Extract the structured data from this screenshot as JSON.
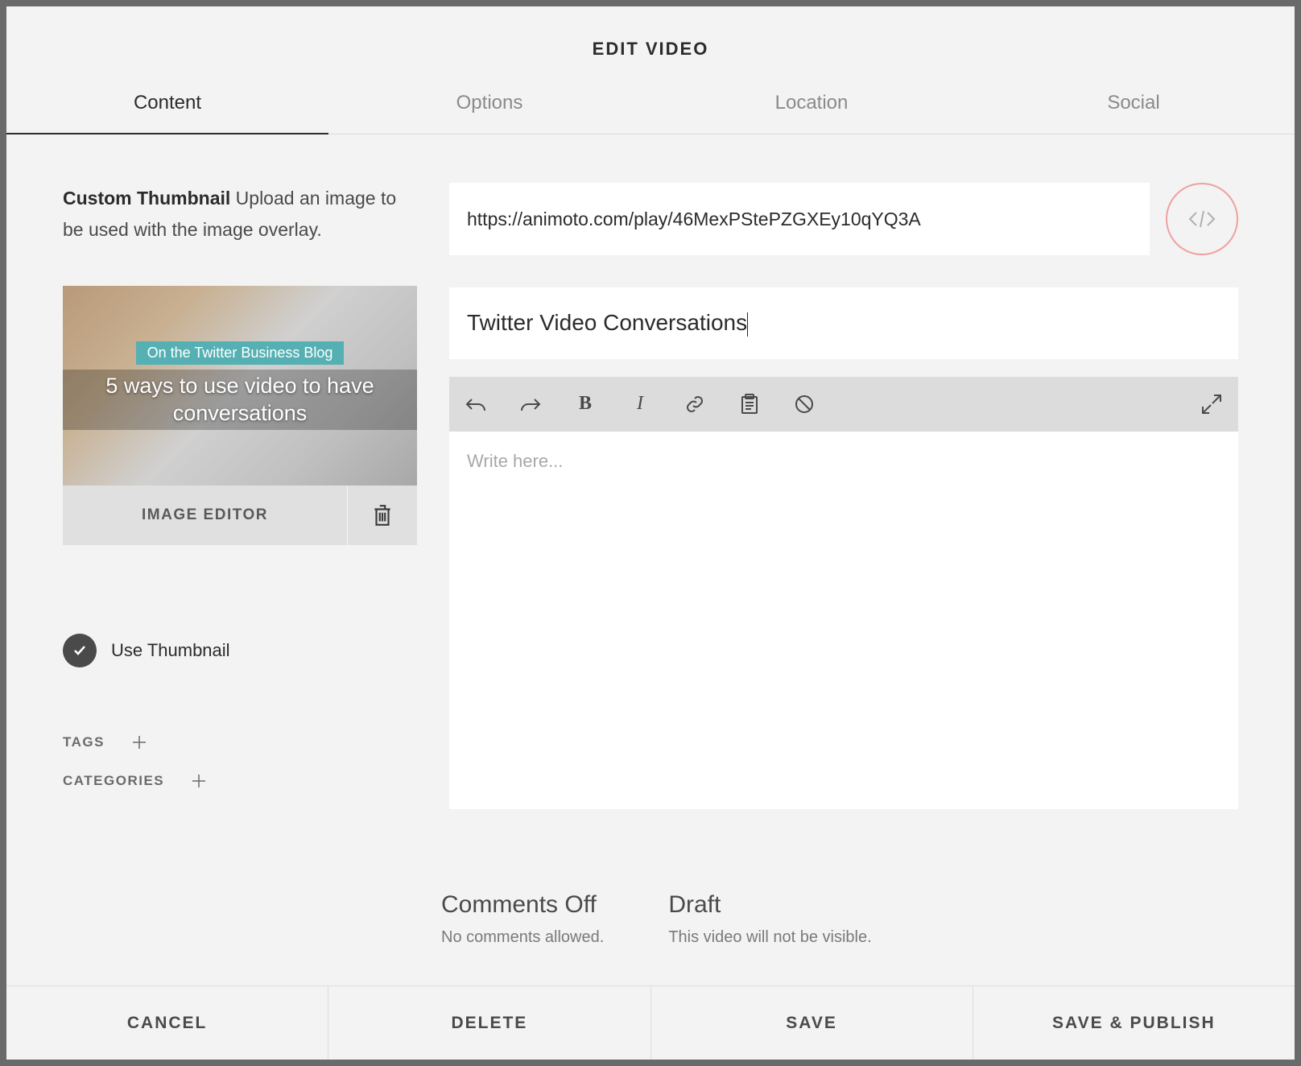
{
  "modal_title": "EDIT VIDEO",
  "tabs": [
    {
      "label": "Content",
      "active": true
    },
    {
      "label": "Options",
      "active": false
    },
    {
      "label": "Location",
      "active": false
    },
    {
      "label": "Social",
      "active": false
    }
  ],
  "thumbnail": {
    "label_bold": "Custom Thumbnail",
    "label_rest": " Upload an image to be used with the image overlay.",
    "overlay_tag": "On the Twitter Business Blog",
    "overlay_headline": "5 ways to use video to have conversations",
    "image_editor_label": "IMAGE EDITOR",
    "use_thumb_label": "Use Thumbnail"
  },
  "url_field": {
    "value": "https://animoto.com/play/46MexPStePZGXEy10qYQ3A"
  },
  "title_field": {
    "value": "Twitter Video Conversations"
  },
  "editor": {
    "placeholder": "Write here..."
  },
  "meta": {
    "tags_label": "TAGS",
    "categories_label": "CATEGORIES"
  },
  "status": {
    "comments_title": "Comments Off",
    "comments_sub": "No comments allowed.",
    "draft_title": "Draft",
    "draft_sub": "This video will not be visible."
  },
  "footer": {
    "cancel": "CANCEL",
    "delete": "DELETE",
    "save": "SAVE",
    "save_publish": "SAVE & PUBLISH"
  }
}
